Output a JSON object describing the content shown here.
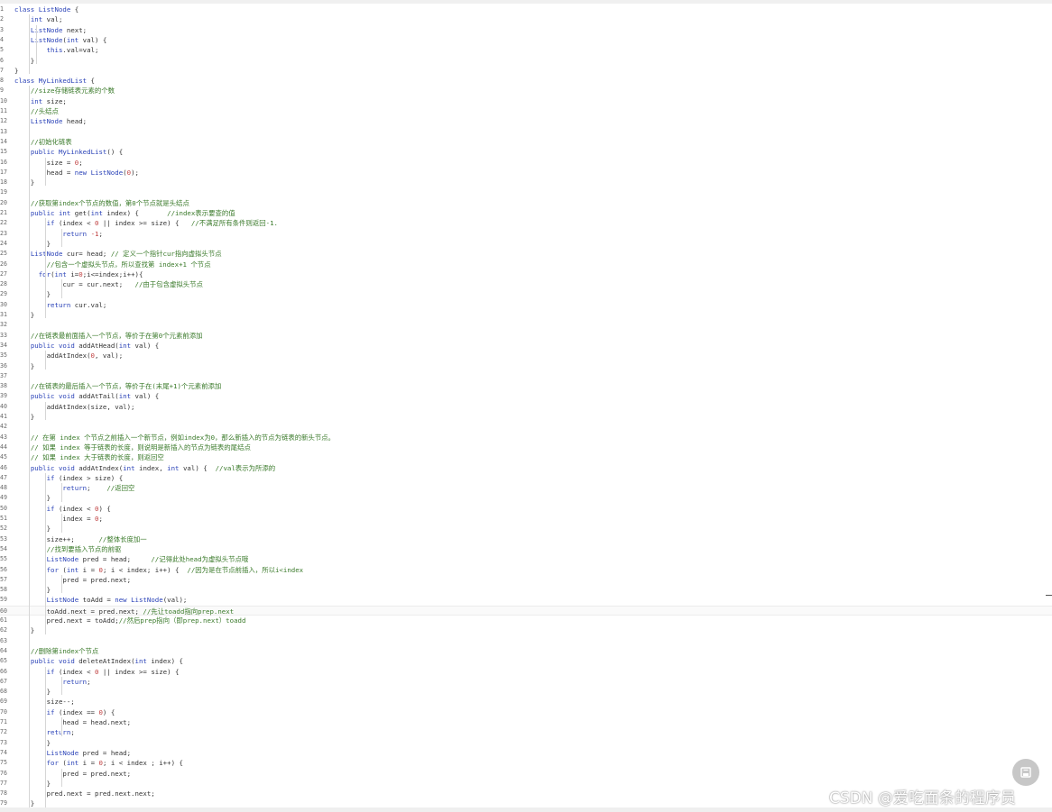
{
  "editor": {
    "lines": [
      {
        "n": "1",
        "t": "class ListNode {"
      },
      {
        "n": "2",
        "t": "    int val;"
      },
      {
        "n": "3",
        "t": "    ListNode next;"
      },
      {
        "n": "4",
        "t": "    ListNode(int val) {"
      },
      {
        "n": "5",
        "t": "        this.val=val;"
      },
      {
        "n": "6",
        "t": "    }"
      },
      {
        "n": "7",
        "t": "}"
      },
      {
        "n": "8",
        "t": "class MyLinkedList {"
      },
      {
        "n": "9",
        "t": "    //size存储链表元素的个数"
      },
      {
        "n": "10",
        "t": "    int size;"
      },
      {
        "n": "11",
        "t": "    //头结点"
      },
      {
        "n": "12",
        "t": "    ListNode head;"
      },
      {
        "n": "13",
        "t": ""
      },
      {
        "n": "14",
        "t": "    //初始化链表"
      },
      {
        "n": "15",
        "t": "    public MyLinkedList() {"
      },
      {
        "n": "16",
        "t": "        size = 0;"
      },
      {
        "n": "17",
        "t": "        head = new ListNode(0);"
      },
      {
        "n": "18",
        "t": "    }"
      },
      {
        "n": "19",
        "t": ""
      },
      {
        "n": "20",
        "t": "    //获取第index个节点的数值，第0个节点就是头结点"
      },
      {
        "n": "21",
        "t": "    public int get(int index) {       //index表示要查的值"
      },
      {
        "n": "22",
        "t": "        if (index < 0 || index >= size) {   //不满足所有条件则返回-1."
      },
      {
        "n": "23",
        "t": "            return -1;"
      },
      {
        "n": "24",
        "t": "        }"
      },
      {
        "n": "25",
        "t": "    ListNode cur= head; // 定义一个指针cur指向虚拟头节点"
      },
      {
        "n": "26",
        "t": "        //包含一个虚拟头节点，所以查找第 index+1 个节点"
      },
      {
        "n": "27",
        "t": "      for(int i=0;i<=index;i++){"
      },
      {
        "n": "28",
        "t": "            cur = cur.next;   //由于包含虚拟头节点"
      },
      {
        "n": "29",
        "t": "        }"
      },
      {
        "n": "30",
        "t": "        return cur.val;"
      },
      {
        "n": "31",
        "t": "    }"
      },
      {
        "n": "32",
        "t": ""
      },
      {
        "n": "33",
        "t": "    //在链表最前面插入一个节点，等价于在第0个元素前添加"
      },
      {
        "n": "34",
        "t": "    public void addAtHead(int val) {"
      },
      {
        "n": "35",
        "t": "        addAtIndex(0, val);"
      },
      {
        "n": "36",
        "t": "    }"
      },
      {
        "n": "37",
        "t": ""
      },
      {
        "n": "38",
        "t": "    //在链表的最后插入一个节点，等价于在(末尾+1)个元素前添加"
      },
      {
        "n": "39",
        "t": "    public void addAtTail(int val) {"
      },
      {
        "n": "40",
        "t": "        addAtIndex(size, val);"
      },
      {
        "n": "41",
        "t": "    }"
      },
      {
        "n": "42",
        "t": ""
      },
      {
        "n": "43",
        "t": "    // 在第 index 个节点之前插入一个新节点，例如index为0，那么新插入的节点为链表的新头节点。"
      },
      {
        "n": "44",
        "t": "    // 如果 index 等于链表的长度，则说明是新插入的节点为链表的尾结点"
      },
      {
        "n": "45",
        "t": "    // 如果 index 大于链表的长度，则返回空"
      },
      {
        "n": "46",
        "t": "    public void addAtIndex(int index, int val) {  //val表示为所添的"
      },
      {
        "n": "47",
        "t": "        if (index > size) {"
      },
      {
        "n": "48",
        "t": "            return;    //返回空"
      },
      {
        "n": "49",
        "t": "        }"
      },
      {
        "n": "50",
        "t": "        if (index < 0) {"
      },
      {
        "n": "51",
        "t": "            index = 0;"
      },
      {
        "n": "52",
        "t": "        }"
      },
      {
        "n": "53",
        "t": "        size++;      //整体长度加一"
      },
      {
        "n": "54",
        "t": "        //找到要插入节点的前驱"
      },
      {
        "n": "55",
        "t": "        ListNode pred = head;     //记得此处head为虚拟头节点哦"
      },
      {
        "n": "56",
        "t": "        for (int i = 0; i < index; i++) {  //因为是在节点前插入，所以i<index"
      },
      {
        "n": "57",
        "t": "            pred = pred.next;"
      },
      {
        "n": "58",
        "t": "        }"
      },
      {
        "n": "59",
        "t": "        ListNode toAdd = new ListNode(val);"
      },
      {
        "n": "60",
        "t": "        toAdd.next = pred.next; //先让toadd指向prep.next"
      },
      {
        "n": "61",
        "t": "        pred.next = toAdd;//然后prep指向（即prep.next）toadd"
      },
      {
        "n": "62",
        "t": "    }"
      },
      {
        "n": "63",
        "t": ""
      },
      {
        "n": "64",
        "t": "    //删除第index个节点"
      },
      {
        "n": "65",
        "t": "    public void deleteAtIndex(int index) {"
      },
      {
        "n": "66",
        "t": "        if (index < 0 || index >= size) {"
      },
      {
        "n": "67",
        "t": "            return;"
      },
      {
        "n": "68",
        "t": "        }"
      },
      {
        "n": "69",
        "t": "        size--;"
      },
      {
        "n": "70",
        "t": "        if (index == 0) {"
      },
      {
        "n": "71",
        "t": "            head = head.next;"
      },
      {
        "n": "72",
        "t": "        return;"
      },
      {
        "n": "73",
        "t": "        }"
      },
      {
        "n": "74",
        "t": "        ListNode pred = head;"
      },
      {
        "n": "75",
        "t": "        for (int i = 0; i < index ; i++) {"
      },
      {
        "n": "76",
        "t": "            pred = pred.next;"
      },
      {
        "n": "77",
        "t": "        }"
      },
      {
        "n": "78",
        "t": "        pred.next = pred.next.next;"
      },
      {
        "n": "79",
        "t": "    }"
      }
    ]
  },
  "watermark": "CSDN @爱吃面条的程序员",
  "fab_icon": "print-icon"
}
